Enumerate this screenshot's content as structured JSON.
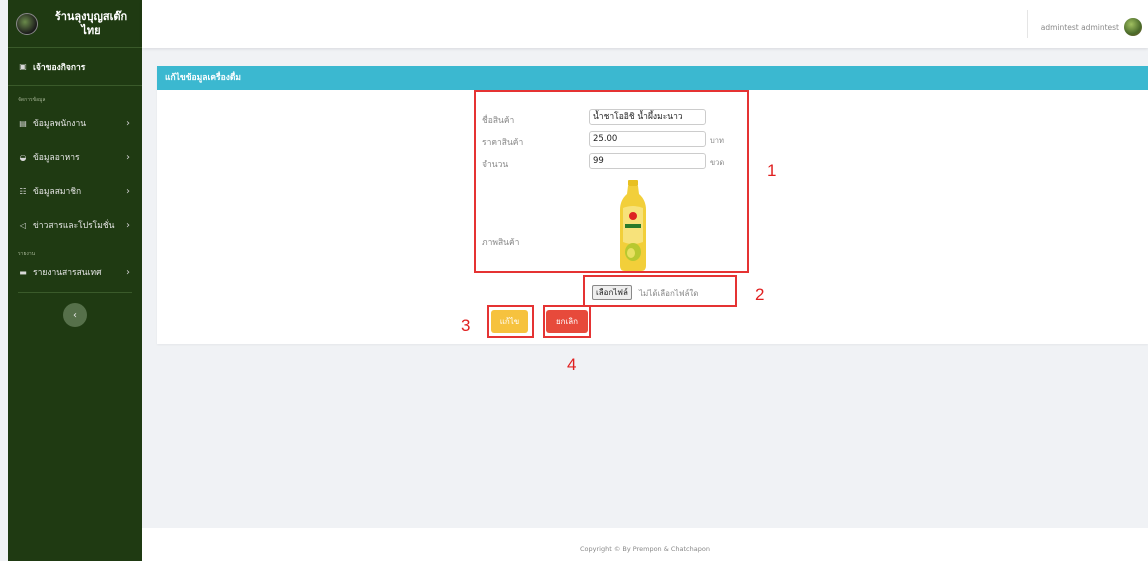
{
  "sidebar": {
    "brand_title": "ร้านลุงบุญสเต๊กไทย",
    "head_item": "เจ้าของกิจการ",
    "section1_label": "จัดการข้อมูล",
    "items": [
      {
        "label": "ข้อมูลพนักงาน",
        "icon": "id-card-icon"
      },
      {
        "label": "ข้อมูลอาหาร",
        "icon": "food-bowl-icon"
      },
      {
        "label": "ข้อมูลสมาชิก",
        "icon": "users-icon"
      },
      {
        "label": "ข่าวสารและโปรโมชั่น",
        "icon": "megaphone-icon"
      }
    ],
    "section2_label": "รายงาน",
    "report_item": "รายงานสารสนเทศ"
  },
  "topbar": {
    "user_name": "admintest admintest"
  },
  "card": {
    "header": "แก้ไขข้อมูลเครื่องดื่ม"
  },
  "form": {
    "name_label": "ชื่อสินค้า",
    "name_value": "น้ำชาโออิชิ น้ำผึ้งมะนาว",
    "price_label": "ราคาสินค้า",
    "price_value": "25.00",
    "price_unit": "บาท",
    "qty_label": "จำนวน",
    "qty_value": "99",
    "qty_unit": "ขวด",
    "image_label": "ภาพสินค้า",
    "file_button": "เลือกไฟล์",
    "file_status": "ไม่ได้เลือกไฟล์ใด",
    "edit_button": "แก้ไข",
    "cancel_button": "ยกเลิก"
  },
  "annotations": [
    "1",
    "2",
    "3",
    "4"
  ],
  "footer": {
    "text": "Copyright © By Prempon & Chatchapon"
  },
  "colors": {
    "sidebar_bg": "#1f3a12",
    "header_accent": "#3bb8d0",
    "edit_btn": "#f6c23e",
    "cancel_btn": "#e74a3b",
    "annotation": "#e53333"
  }
}
